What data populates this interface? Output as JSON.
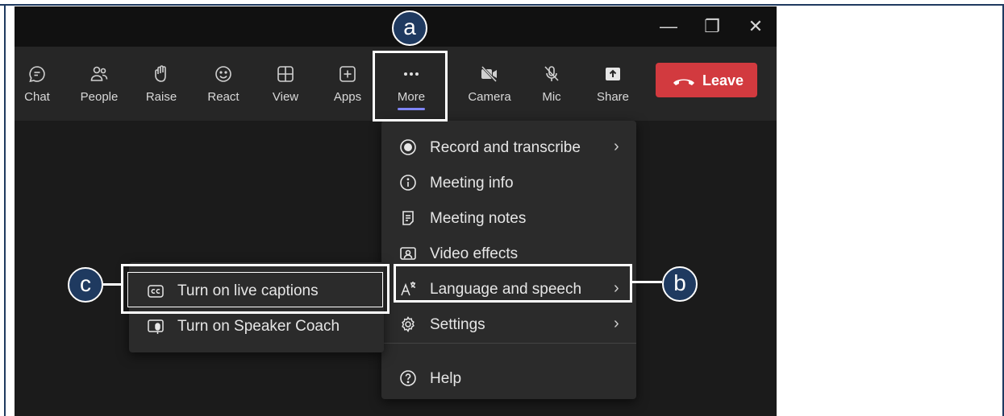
{
  "window_controls": {
    "minimize": "—",
    "restore": "❐",
    "close": "✕"
  },
  "toolbar": {
    "buttons": [
      {
        "label": "Chat",
        "icon": "chat-icon"
      },
      {
        "label": "People",
        "icon": "people-icon"
      },
      {
        "label": "Raise",
        "icon": "raise-hand-icon"
      },
      {
        "label": "React",
        "icon": "react-smiley-icon"
      },
      {
        "label": "View",
        "icon": "view-grid-icon"
      },
      {
        "label": "Apps",
        "icon": "apps-plus-icon"
      },
      {
        "label": "More",
        "icon": "more-ellipsis-icon",
        "active": true
      },
      {
        "label": "Camera",
        "icon": "camera-off-icon"
      },
      {
        "label": "Mic",
        "icon": "mic-off-icon"
      },
      {
        "label": "Share",
        "icon": "share-icon"
      }
    ],
    "leave_label": "Leave"
  },
  "more_menu": {
    "items": [
      {
        "label": "Record and transcribe",
        "icon": "record-icon",
        "chevron": "›"
      },
      {
        "label": "Meeting info",
        "icon": "info-icon"
      },
      {
        "label": "Meeting notes",
        "icon": "notes-icon"
      },
      {
        "label": "Video effects",
        "icon": "video-effects-icon"
      },
      {
        "label": "Language and speech",
        "icon": "language-icon",
        "chevron": "›"
      },
      {
        "label": "Settings",
        "icon": "settings-gear-icon",
        "chevron": "›"
      },
      {
        "label": "Help",
        "icon": "help-icon"
      }
    ]
  },
  "language_submenu": {
    "items": [
      {
        "label": "Turn on live captions",
        "icon": "cc-icon"
      },
      {
        "label": "Turn on Speaker Coach",
        "icon": "speaker-coach-icon"
      }
    ]
  },
  "callouts": {
    "a": "a",
    "b": "b",
    "c": "c"
  },
  "colors": {
    "callout": "#1f3a60",
    "leave": "#d23a3f",
    "accent_underline": "#7f85f5"
  }
}
